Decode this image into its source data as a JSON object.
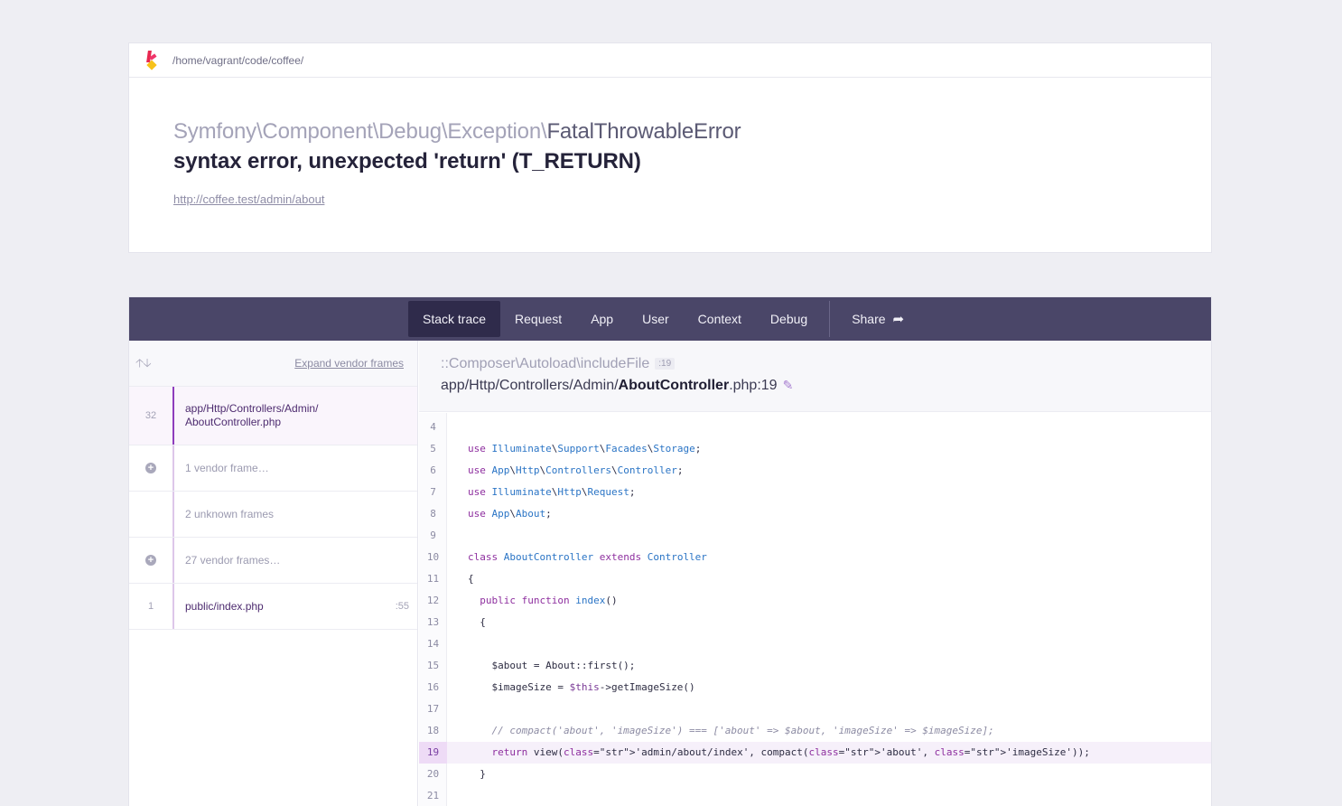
{
  "header": {
    "path": "/home/vagrant/code/coffee/",
    "exception_namespace": "Symfony\\Component\\Debug\\Exception\\",
    "exception_short": "FatalThrowableError",
    "message": "syntax error, unexpected 'return' (T_RETURN)",
    "url": "http://coffee.test/admin/about"
  },
  "nav": {
    "tabs": [
      "Stack trace",
      "Request",
      "App",
      "User",
      "Context",
      "Debug"
    ],
    "active_tab": "Stack trace",
    "share": "Share"
  },
  "stack": {
    "expand_label": "Expand vendor frames",
    "frames": [
      {
        "number": "32",
        "line1": "app/Http/Controllers/Admin/",
        "line2": "AboutController.php",
        "active": true
      },
      {
        "label": "1 vendor frame…",
        "collapsed": true
      },
      {
        "label": "2 unknown frames"
      },
      {
        "label": "27 vendor frames…",
        "collapsed": true
      },
      {
        "number": "1",
        "label": "public/index.php",
        "line": ":55"
      }
    ]
  },
  "code_header": {
    "class": "::Composer\\Autoload\\includeFile",
    "class_line": ":19",
    "file_prefix": "app/Http/Controllers/Admin/",
    "file_name": "AboutController",
    "file_suffix": ".php:19"
  },
  "code": {
    "highlight_line": 19,
    "lines": [
      {
        "n": "4",
        "text": ""
      },
      {
        "n": "5",
        "text": "use Illuminate\\Support\\Facades\\Storage;"
      },
      {
        "n": "6",
        "text": "use App\\Http\\Controllers\\Controller;"
      },
      {
        "n": "7",
        "text": "use Illuminate\\Http\\Request;"
      },
      {
        "n": "8",
        "text": "use App\\About;"
      },
      {
        "n": "9",
        "text": ""
      },
      {
        "n": "10",
        "text": "class AboutController extends Controller"
      },
      {
        "n": "11",
        "text": "{"
      },
      {
        "n": "12",
        "text": "  public function index()"
      },
      {
        "n": "13",
        "text": "  {"
      },
      {
        "n": "14",
        "text": ""
      },
      {
        "n": "15",
        "text": "    $about = About::first();"
      },
      {
        "n": "16",
        "text": "    $imageSize = $this->getImageSize()"
      },
      {
        "n": "17",
        "text": ""
      },
      {
        "n": "18",
        "text": "    // compact('about', 'imageSize') === ['about' => $about, 'imageSize' => $imageSize];"
      },
      {
        "n": "19",
        "text": "    return view('admin/about/index', compact('about', 'imageSize'));"
      },
      {
        "n": "20",
        "text": "  }"
      },
      {
        "n": "21",
        "text": ""
      }
    ]
  },
  "colors": {
    "nav_bg": "#4a4668",
    "nav_active": "#2f2b4b",
    "accent_purple": "#8e3dbd",
    "highlight_bg": "#f6f0fa"
  }
}
